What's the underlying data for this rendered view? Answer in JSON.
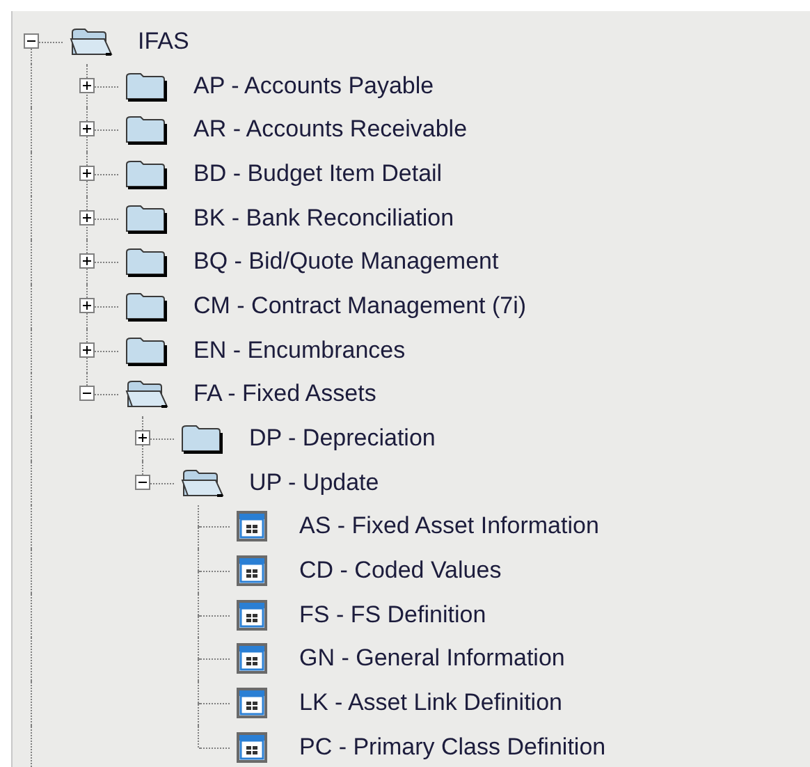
{
  "tree": [
    {
      "label": "IFAS",
      "kind": "folder",
      "expanded": true,
      "children": [
        {
          "label": "AP - Accounts Payable",
          "kind": "folder",
          "expanded": false
        },
        {
          "label": "AR - Accounts Receivable",
          "kind": "folder",
          "expanded": false
        },
        {
          "label": "BD - Budget Item Detail",
          "kind": "folder",
          "expanded": false
        },
        {
          "label": "BK - Bank Reconciliation",
          "kind": "folder",
          "expanded": false
        },
        {
          "label": "BQ - Bid/Quote Management",
          "kind": "folder",
          "expanded": false
        },
        {
          "label": "CM - Contract Management (7i)",
          "kind": "folder",
          "expanded": false
        },
        {
          "label": "EN - Encumbrances",
          "kind": "folder",
          "expanded": false
        },
        {
          "label": "FA - Fixed Assets",
          "kind": "folder",
          "expanded": true,
          "children": [
            {
              "label": "DP - Depreciation",
              "kind": "folder",
              "expanded": false
            },
            {
              "label": "UP - Update",
              "kind": "folder",
              "expanded": true,
              "children": [
                {
                  "label": "AS - Fixed Asset Information",
                  "kind": "form"
                },
                {
                  "label": "CD - Coded Values",
                  "kind": "form"
                },
                {
                  "label": "FS - FS Definition",
                  "kind": "form"
                },
                {
                  "label": "GN - General Information",
                  "kind": "form"
                },
                {
                  "label": "LK - Asset Link Definition",
                  "kind": "form"
                },
                {
                  "label": "PC - Primary Class Definition",
                  "kind": "form"
                }
              ]
            }
          ]
        }
      ]
    }
  ]
}
